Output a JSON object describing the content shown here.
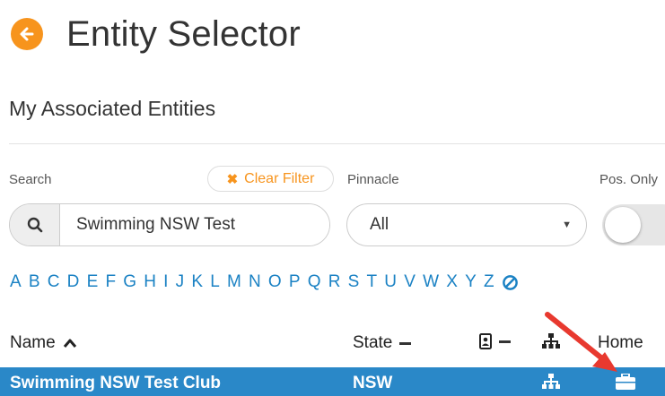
{
  "page": {
    "title": "Entity Selector",
    "back_icon": "arrow-left-icon",
    "accent_color": "#f7941d"
  },
  "section": {
    "title": "My Associated Entities"
  },
  "filters": {
    "search_label": "Search",
    "clear_filter_label": "Clear Filter",
    "search_value": "Swimming NSW Test",
    "pinnacle_label": "Pinnacle",
    "pinnacle_selected": "All",
    "pos_only_label": "Pos. Only",
    "pos_only_on": false
  },
  "alphabet": [
    "A",
    "B",
    "C",
    "D",
    "E",
    "F",
    "G",
    "H",
    "I",
    "J",
    "K",
    "L",
    "M",
    "N",
    "O",
    "P",
    "Q",
    "R",
    "S",
    "T",
    "U",
    "V",
    "W",
    "X",
    "Y",
    "Z"
  ],
  "table": {
    "columns": {
      "name": "Name",
      "state": "State",
      "home": "Home"
    },
    "rows": [
      {
        "name": "Swimming NSW Test Club",
        "state": "NSW"
      }
    ],
    "selected_row_color": "#2a88c8"
  },
  "annotation": {
    "arrow_color": "#e8392f"
  }
}
